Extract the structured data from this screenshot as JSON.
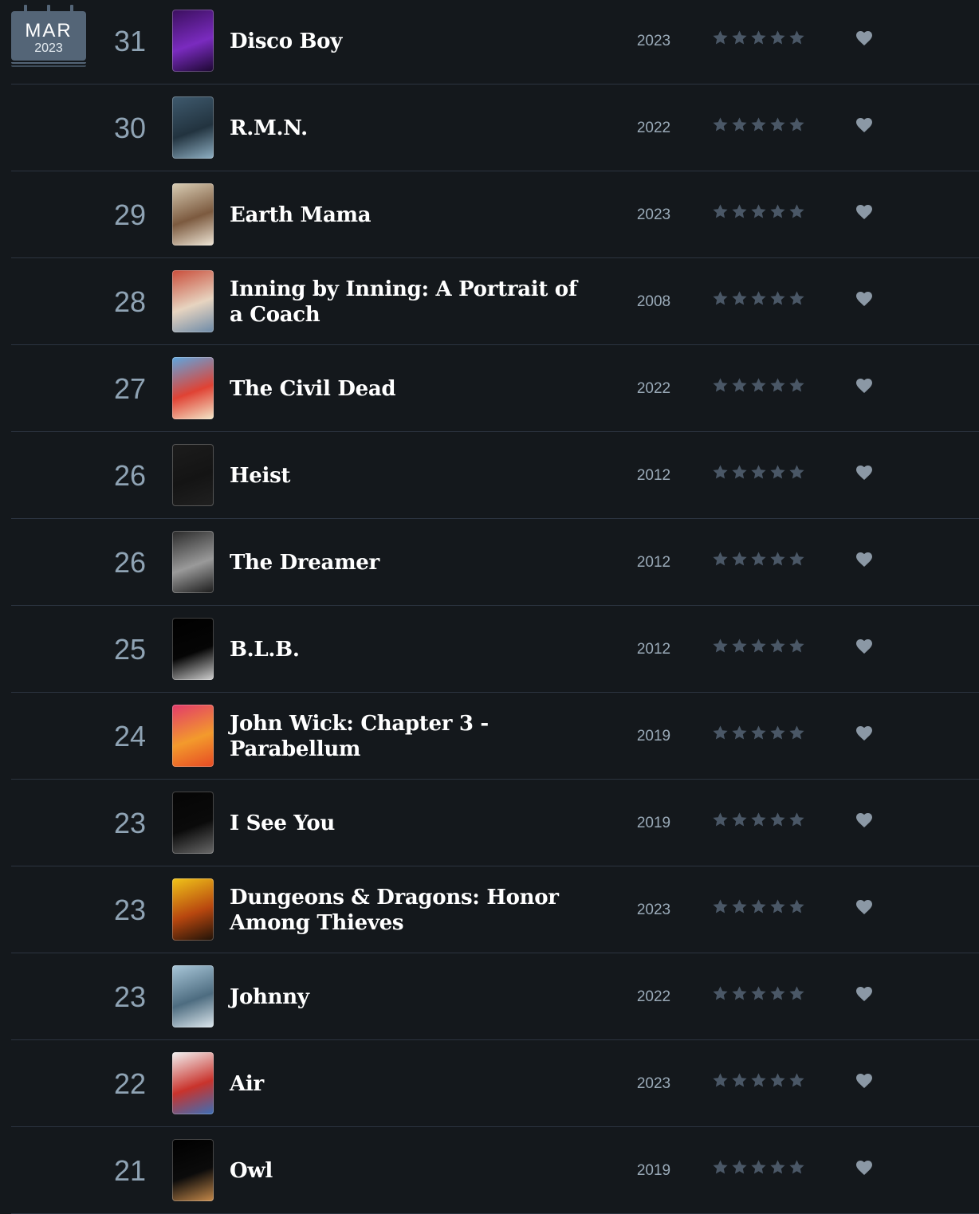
{
  "calendar": {
    "month": "MAR",
    "year": "2023"
  },
  "colors": {
    "background": "#14181c",
    "divider": "#2c3440",
    "day_text": "#8fa3b4",
    "star_empty": "#4a5766",
    "heart": "#8b98a5"
  },
  "entries": [
    {
      "day": "31",
      "title": "Disco Boy",
      "year": "2023",
      "rating": 0,
      "poster_colors": [
        "#3b0f5e",
        "#7a2bbf",
        "#1b0730"
      ]
    },
    {
      "day": "30",
      "title": "R.M.N.",
      "year": "2022",
      "rating": 0,
      "poster_colors": [
        "#3f5a6e",
        "#22333f",
        "#8fb0c4"
      ]
    },
    {
      "day": "29",
      "title": "Earth Mama",
      "year": "2023",
      "rating": 0,
      "poster_colors": [
        "#d9cdb4",
        "#7c5a3f",
        "#efe6d6"
      ]
    },
    {
      "day": "28",
      "title": "Inning by Inning: A Portrait of a Coach",
      "year": "2008",
      "rating": 0,
      "poster_colors": [
        "#c94d3a",
        "#e7d4c0",
        "#6c8aa8"
      ]
    },
    {
      "day": "27",
      "title": "The Civil Dead",
      "year": "2022",
      "rating": 0,
      "poster_colors": [
        "#5da7e0",
        "#e04234",
        "#f4e7c8"
      ]
    },
    {
      "day": "26",
      "title": "Heist",
      "year": "2012",
      "rating": 0,
      "poster_colors": [
        "#1c1c1c",
        "#141414",
        "#202020"
      ]
    },
    {
      "day": "26",
      "title": "The Dreamer",
      "year": "2012",
      "rating": 0,
      "poster_colors": [
        "#2a2a2a",
        "#9a9a9a",
        "#1a1a1a"
      ]
    },
    {
      "day": "25",
      "title": "B.L.B.",
      "year": "2012",
      "rating": 0,
      "poster_colors": [
        "#000000",
        "#050505",
        "#d0d0d0"
      ]
    },
    {
      "day": "24",
      "title": "John Wick: Chapter 3 - Parabellum",
      "year": "2019",
      "rating": 0,
      "poster_colors": [
        "#e23a6b",
        "#f39a2c",
        "#e64a24"
      ]
    },
    {
      "day": "23",
      "title": "I See You",
      "year": "2019",
      "rating": 0,
      "poster_colors": [
        "#050505",
        "#0a0a0a",
        "#6a6a6a"
      ]
    },
    {
      "day": "23",
      "title": "Dungeons & Dragons: Honor Among Thieves",
      "year": "2023",
      "rating": 0,
      "poster_colors": [
        "#f0c419",
        "#b8470f",
        "#1e1208"
      ]
    },
    {
      "day": "23",
      "title": "Johnny",
      "year": "2022",
      "rating": 0,
      "poster_colors": [
        "#a9c7d9",
        "#4d6c80",
        "#dde8ee"
      ]
    },
    {
      "day": "22",
      "title": "Air",
      "year": "2023",
      "rating": 0,
      "poster_colors": [
        "#f2f2f2",
        "#c9332c",
        "#3b6fb8"
      ]
    },
    {
      "day": "21",
      "title": "Owl",
      "year": "2019",
      "rating": 0,
      "poster_colors": [
        "#000000",
        "#0b0b0b",
        "#c78a4a"
      ]
    }
  ]
}
